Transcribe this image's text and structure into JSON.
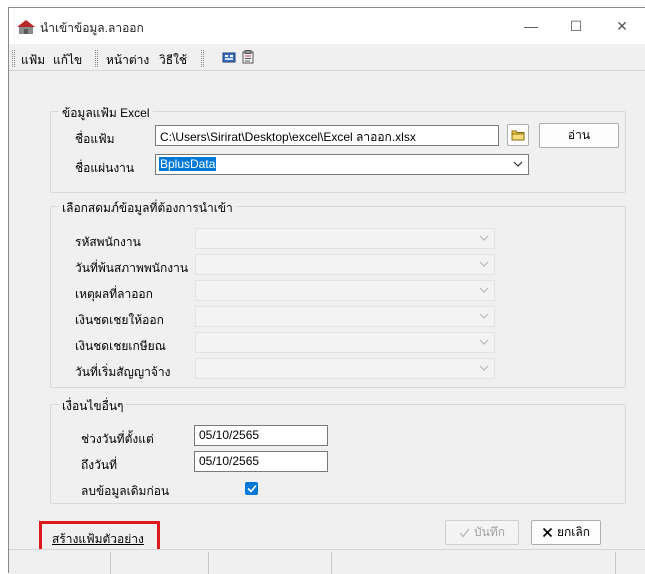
{
  "window": {
    "title": "นำเข้าข้อมูล.ลาออก",
    "minimize_glyph": "—",
    "maximize_glyph": "☐",
    "close_glyph": "✕"
  },
  "menu": {
    "items": [
      "แฟ้ม",
      "แก้ไข",
      "หน้าต่าง",
      "วิธีใช้"
    ],
    "toolbar_icons": [
      "calculator-icon",
      "clipboard-icon"
    ]
  },
  "excel_group": {
    "title": "ข้อมูลแฟ้ม Excel",
    "file_label": "ชื่อแฟ้ม",
    "file_value": "C:\\Users\\Sirirat\\Desktop\\excel\\Excel ลาออก.xlsx",
    "browse_icon": "folder-icon",
    "read_button": "อ่าน",
    "sheet_label": "ชื่อแผ่นงาน",
    "sheet_value": "BplusData"
  },
  "columns_group": {
    "title": "เลือกสดมภ์ข้อมูลที่ต้องการนำเข้า",
    "fields": [
      {
        "label": "รหัสพนักงาน"
      },
      {
        "label": "วันที่พ้นสภาพพนักงาน"
      },
      {
        "label": "เหตุผลที่ลาออก"
      },
      {
        "label": "เงินชดเชยให้ออก"
      },
      {
        "label": "เงินชดเชยเกษียณ"
      },
      {
        "label": "วันที่เริ่มสัญญาจ้าง"
      }
    ]
  },
  "conditions_group": {
    "title": "เงื่อนไขอื่นๆ",
    "start_label": "ช่วงวันที่ตั้งแต่",
    "start_value": "05/10/2565",
    "end_label": "ถึงวันที่",
    "end_value": "05/10/2565",
    "clear_label": "ลบข้อมูลเดิมก่อน",
    "clear_checked": true
  },
  "footer": {
    "sample_link": "สร้างแฟ้มตัวอย่าง",
    "save_button": "บันทึก",
    "cancel_button": "ยกเลิก",
    "highlight_color": "#e0191f"
  },
  "colors": {
    "accent": "#0078d7",
    "window_bg": "#f0f0f0"
  }
}
